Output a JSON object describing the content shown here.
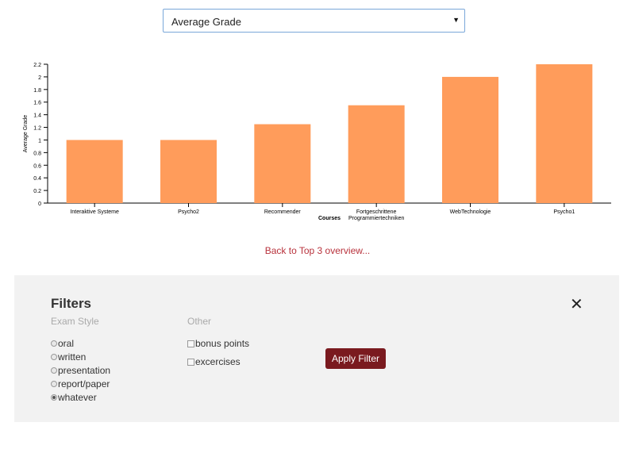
{
  "metric_select": {
    "value": "Average Grade"
  },
  "chart_data": {
    "type": "bar",
    "categories": [
      "Interaktive Systeme",
      "Psycho2",
      "Recommender",
      "Fortgeschrittene Programmiertechniken",
      "WebTechnologie",
      "Psycho1"
    ],
    "category_lines": [
      [
        "Interaktive Systeme"
      ],
      [
        "Psycho2"
      ],
      [
        "Recommender"
      ],
      [
        "Fortgeschrittene",
        "Programmiertechniken"
      ],
      [
        "WebTechnologie"
      ],
      [
        "Psycho1"
      ]
    ],
    "values": [
      1.0,
      1.0,
      1.25,
      1.55,
      2.0,
      2.2
    ],
    "xlabel": "Courses",
    "ylabel": "Average Grade",
    "ylim": [
      0,
      2.2
    ],
    "yticks": [
      0,
      0.2,
      0.4,
      0.6,
      0.8,
      1,
      1.2,
      1.4,
      1.6,
      1.8,
      2,
      2.2
    ],
    "bar_color": "#ff9c5b",
    "grid": false
  },
  "back_link": "Back to Top 3 overview...",
  "filters": {
    "title": "Filters",
    "close_glyph": "✕",
    "exam_style": {
      "heading": "Exam Style",
      "options": [
        "oral",
        "written",
        "presentation",
        "report/paper",
        "whatever"
      ],
      "selected": "whatever"
    },
    "other": {
      "heading": "Other",
      "options": [
        "bonus points",
        "excercises"
      ]
    },
    "apply_label": "Apply Filter"
  },
  "colors": {
    "accent": "#7a1a1f",
    "link": "#b8323c",
    "panel": "#f2f2f2"
  }
}
